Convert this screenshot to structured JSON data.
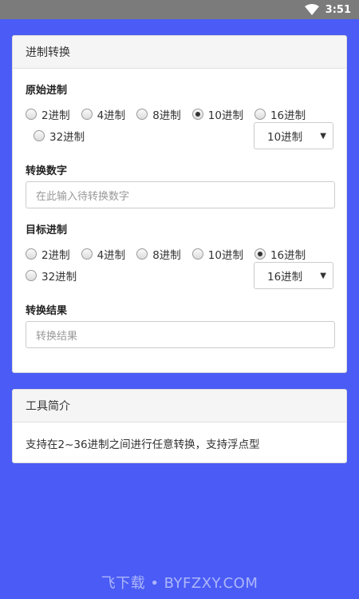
{
  "status_bar": {
    "time": "3:51",
    "wifi_icon": "wifi-icon"
  },
  "converter": {
    "title": "进制转换",
    "source": {
      "label": "原始进制",
      "options": [
        "2进制",
        "4进制",
        "8进制",
        "10进制",
        "16进制",
        "32进制"
      ],
      "selected": "10进制",
      "select_value": "10进制"
    },
    "input": {
      "label": "转换数字",
      "placeholder": "在此输入待转换数字"
    },
    "target": {
      "label": "目标进制",
      "options": [
        "2进制",
        "4进制",
        "8进制",
        "10进制",
        "16进制",
        "32进制"
      ],
      "selected": "16进制",
      "select_value": "16进制"
    },
    "result": {
      "label": "转换结果",
      "placeholder": "转换结果"
    }
  },
  "intro": {
    "title": "工具简介",
    "text": "支持在2~36进制之间进行任意转换，支持浮点型"
  },
  "watermark": "飞下载 • BYFZXY.COM",
  "colors": {
    "background": "#4a5cf5",
    "status_bar": "#7b7b7b"
  }
}
